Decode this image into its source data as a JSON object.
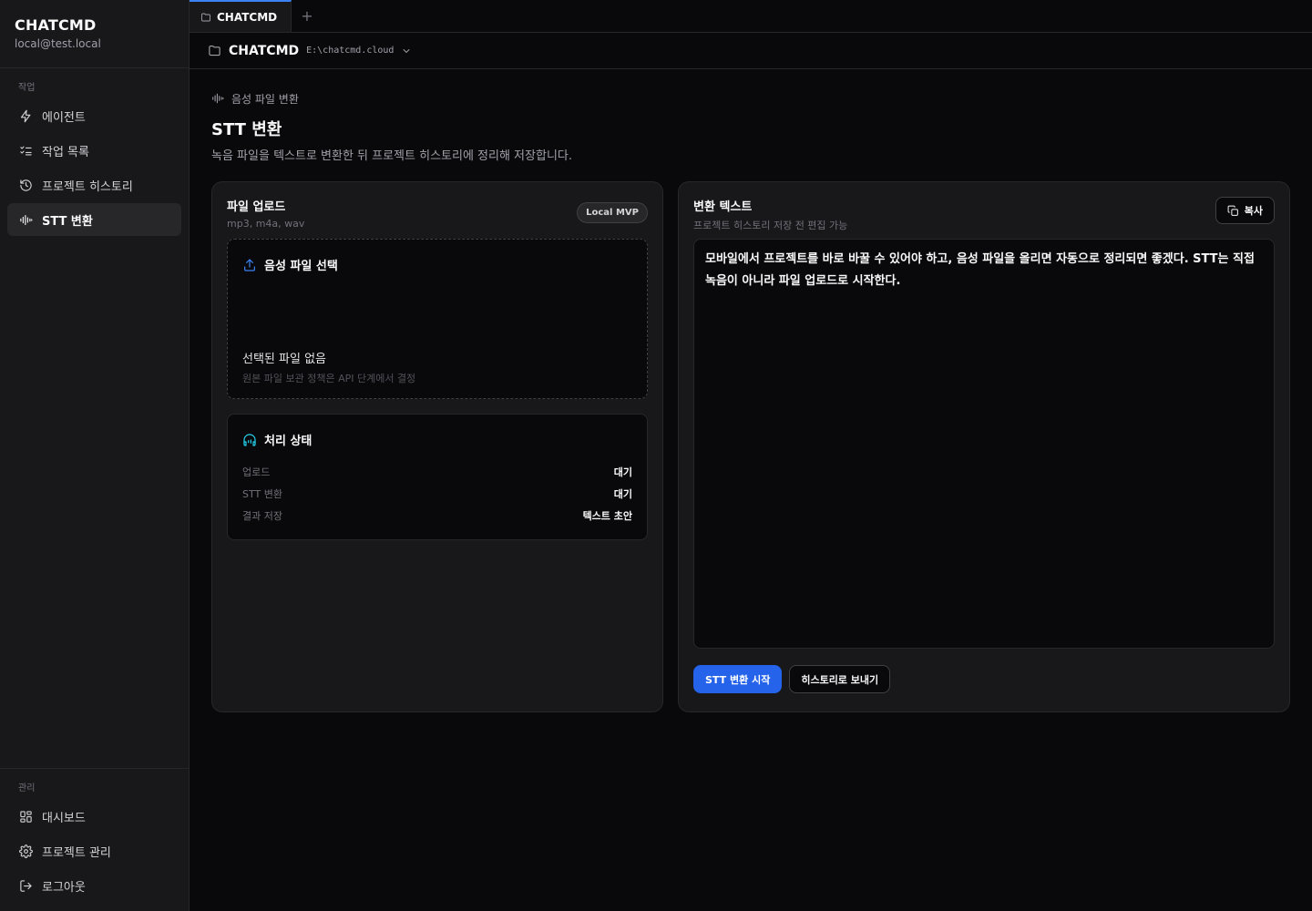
{
  "sidebar": {
    "brand": "CHATCMD",
    "user": "local@test.local",
    "work_heading": "작업",
    "work_items": [
      {
        "label": "에이전트",
        "icon": "bolt-icon"
      },
      {
        "label": "작업 목록",
        "icon": "list-check-icon"
      },
      {
        "label": "프로젝트 히스토리",
        "icon": "history-icon"
      },
      {
        "label": "STT 변환",
        "icon": "audio-wave-icon",
        "active": true
      }
    ],
    "manage_heading": "관리",
    "manage_items": [
      {
        "label": "대시보드",
        "icon": "dashboard-icon"
      },
      {
        "label": "프로젝트 관리",
        "icon": "gear-icon"
      },
      {
        "label": "로그아웃",
        "icon": "logout-icon"
      }
    ]
  },
  "tabs": {
    "active": "CHATCMD",
    "add": "+"
  },
  "pathbar": {
    "name": "CHATCMD",
    "dir": "E:\\chatcmd.cloud"
  },
  "page": {
    "eyebrow": "음성 파일 변환",
    "title": "STT 변환",
    "subtitle": "녹음 파일을 텍스트로 변환한 뒤 프로젝트 히스토리에 정리해 저장합니다."
  },
  "upload": {
    "title": "파일 업로드",
    "formats": "mp3, m4a, wav",
    "badge": "Local MVP",
    "select_label": "음성 파일 선택",
    "file_status": "선택된 파일 없음",
    "note": "원본 파일 보관 정책은 API 단계에서 결정"
  },
  "status": {
    "title": "처리 상태",
    "rows": [
      {
        "key": "업로드",
        "value": "대기"
      },
      {
        "key": "STT 변환",
        "value": "대기"
      },
      {
        "key": "결과 저장",
        "value": "텍스트 초안"
      }
    ]
  },
  "result": {
    "title": "변환 텍스트",
    "subtitle": "프로젝트 히스토리 저장 전 편집 가능",
    "copy_label": "복사",
    "text": "모바일에서 프로젝트를 바로 바꿀 수 있어야 하고, 음성 파일을 올리면 자동으로 정리되면 좋겠다. STT는 직접 녹음이 아니라 파일 업로드로 시작한다.",
    "start_label": "STT 변환 시작",
    "send_label": "히스토리로 보내기"
  },
  "colors": {
    "accent": "#2563eb",
    "background": "#09090b",
    "panel": "#18181b",
    "status_icon": "#22d3ee"
  }
}
